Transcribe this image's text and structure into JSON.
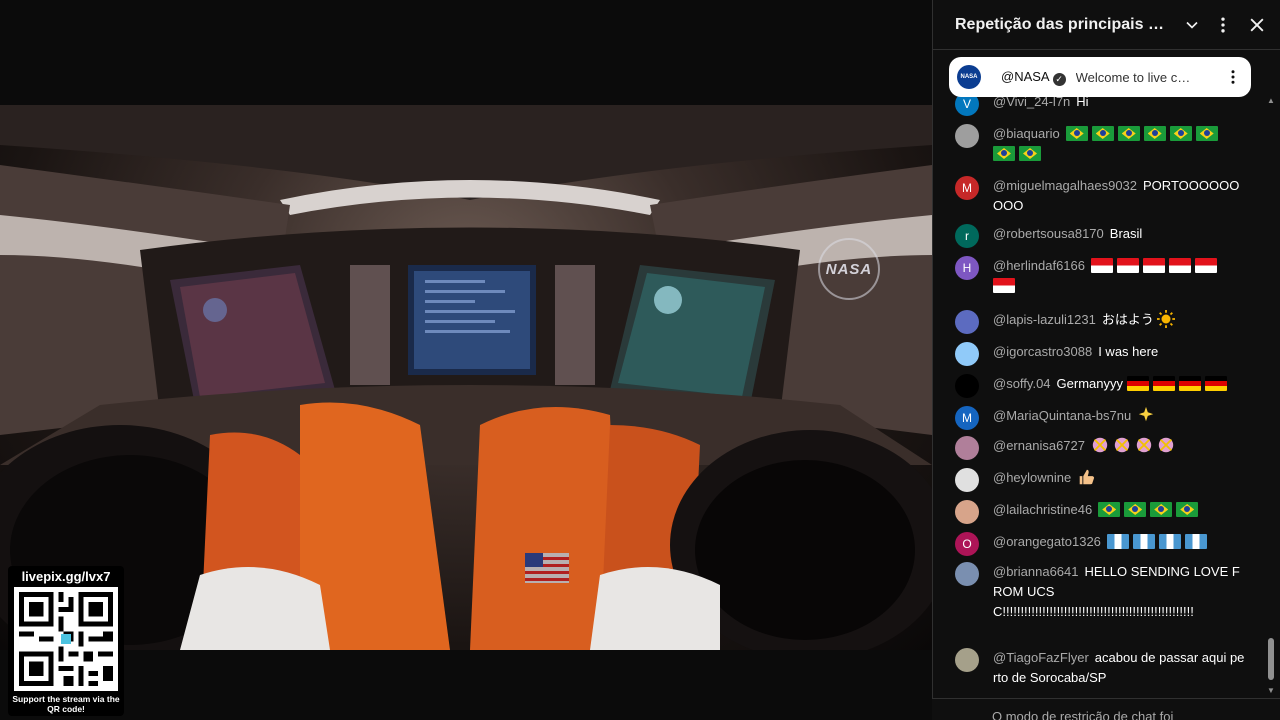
{
  "video": {
    "logo_text": "NASA",
    "qr": {
      "url": "livepix.gg/lvx7",
      "caption": "Support the stream via the QR code!"
    }
  },
  "chat": {
    "title": "Repetição das principais mens…",
    "icons": {
      "dropdown": "chevron-down-icon",
      "more": "more-vert-icon",
      "close": "close-icon"
    },
    "pinned": {
      "avatar_text": "NASA",
      "author": "@NASA",
      "text": "Welcome to live c…"
    },
    "messages": [
      {
        "author": "@Vivi_24-l7n",
        "text": "Hi",
        "avatar_letter": "V",
        "avatar_color": "#0277bd"
      },
      {
        "author": "@biaquario",
        "text": "",
        "avatar_letter": "",
        "avatar_color": "#9e9e9e",
        "flags": [
          "br",
          "br",
          "br",
          "br",
          "br",
          "br",
          "br",
          "br"
        ]
      },
      {
        "author": "@miguelmagalhaes9032",
        "text": "PORTOOOOOOOOO",
        "avatar_letter": "M",
        "avatar_color": "#c62828"
      },
      {
        "author": "@robertsousa8170",
        "text": "Brasil",
        "avatar_letter": "r",
        "avatar_color": "#00695c"
      },
      {
        "author": "@herlindaf6166",
        "text": "",
        "avatar_letter": "H",
        "avatar_color": "#7e57c2",
        "flags": [
          "id",
          "id",
          "id",
          "id",
          "id",
          "id"
        ]
      },
      {
        "author": "@lapis-lazuli1231",
        "text": "おはよう",
        "avatar_letter": "",
        "avatar_color": "#5c6bc0",
        "emoji": "sun"
      },
      {
        "author": "@igorcastro3088",
        "text": "I was here",
        "avatar_letter": "",
        "avatar_color": "#90caf9"
      },
      {
        "author": "@soffy.04",
        "text": "Germanyyy",
        "avatar_letter": "",
        "avatar_color": "#000000",
        "flags": [
          "de",
          "de",
          "de",
          "de"
        ]
      },
      {
        "author": "@MariaQuintana-bs7nu",
        "text": "",
        "avatar_letter": "M",
        "avatar_color": "#1565c0",
        "emoji": "sparkles"
      },
      {
        "author": "@ernanisa6727",
        "text": "",
        "avatar_letter": "",
        "avatar_color": "#b07f9a",
        "emoji": "party"
      },
      {
        "author": "@heylownine",
        "text": "",
        "avatar_letter": "",
        "avatar_color": "#e0e0e0",
        "emoji": "thumbsup"
      },
      {
        "author": "@lailachristine46",
        "text": "",
        "avatar_letter": "",
        "avatar_color": "#d7a48a",
        "flags": [
          "br",
          "br",
          "br",
          "br"
        ]
      },
      {
        "author": "@orangegato1326",
        "text": "",
        "avatar_letter": "O",
        "avatar_color": "#ad1457",
        "flags": [
          "gt",
          "gt",
          "gt",
          "gt"
        ]
      },
      {
        "author": "@brianna6641",
        "text": "HELLO SENDING LOVE FROM UCSC!!!!!!!!!!!!!!!!!!!!!!!!!!!!!!!!!!!!!!!!!!!!!!!!!!!!!",
        "avatar_letter": "",
        "avatar_color": "#7a8fb0"
      },
      {
        "author": "@TiagoFazFlyer",
        "text": "acabou de passar aqui perto de Sorocaba/SP",
        "avatar_letter": "",
        "avatar_color": "#a5a08a"
      }
    ],
    "footer_text": "O modo de restrição de chat foi"
  }
}
